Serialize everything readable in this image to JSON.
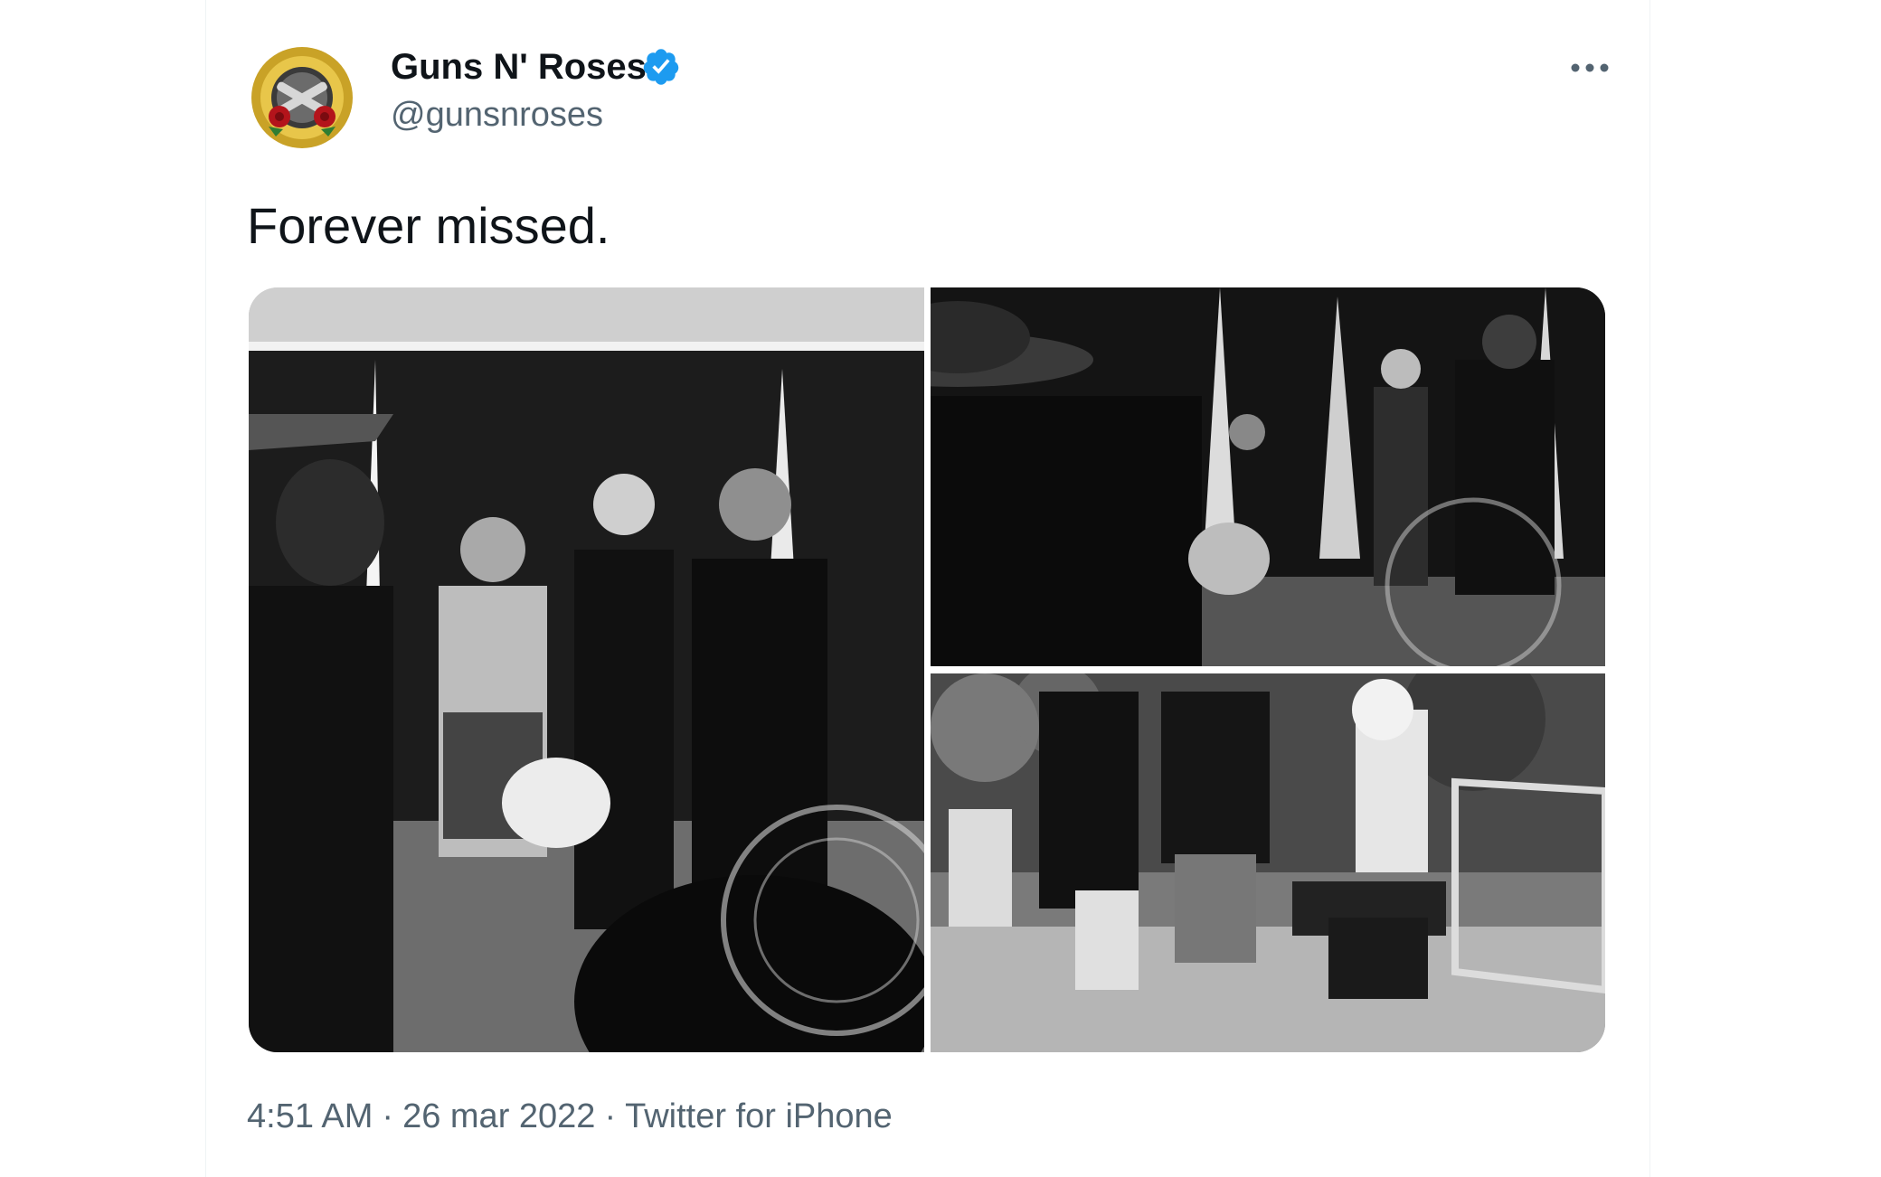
{
  "tweet": {
    "author": {
      "display_name": "Guns N' Roses",
      "handle": "@gunsnroses",
      "verified": true,
      "verified_color": "#1d9bf0"
    },
    "more_icon": "more-horizontal-icon",
    "text": "Forever missed.",
    "media": [
      "photo",
      "photo",
      "photo"
    ],
    "meta": {
      "time": "4:51 AM",
      "separator": "·",
      "date": "26 mar 2022",
      "source": "Twitter for iPhone"
    }
  }
}
